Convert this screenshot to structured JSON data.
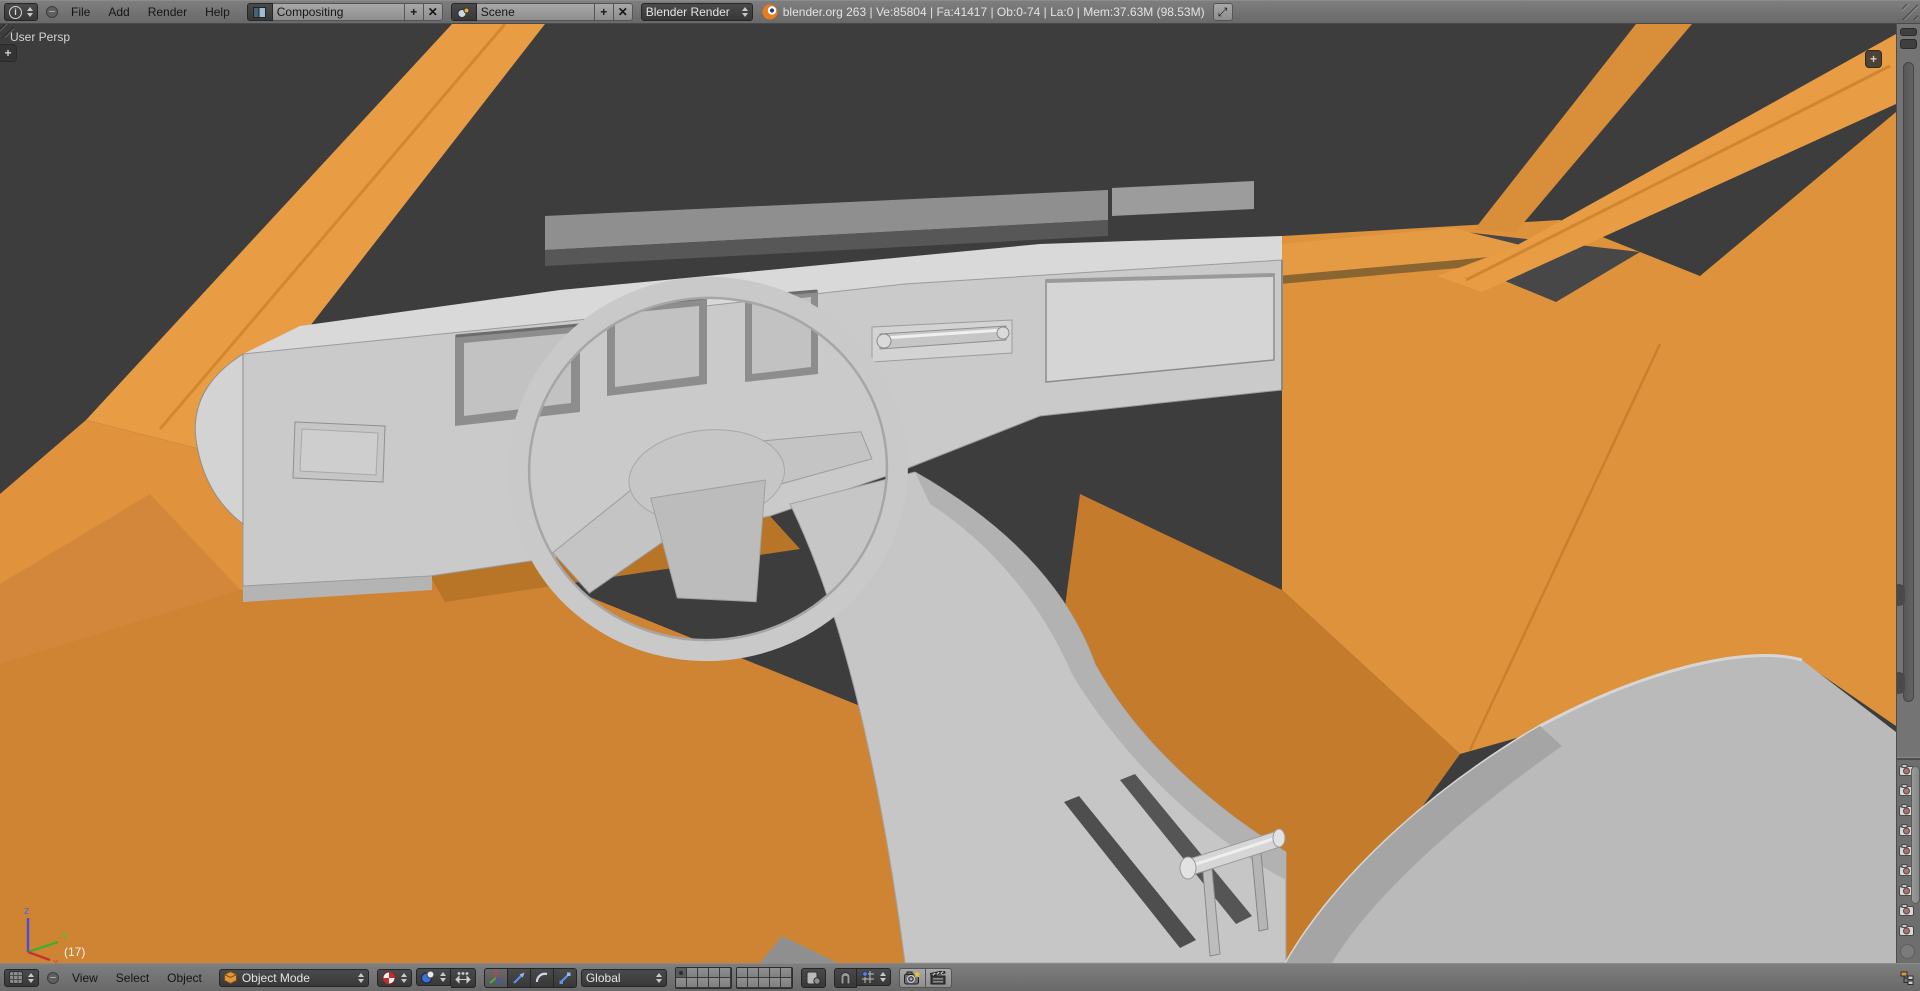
{
  "icons": {
    "plus": "+",
    "close": "✕",
    "collapse": "–",
    "maximize": "⤢",
    "info": "i"
  },
  "topbar": {
    "menus": [
      "File",
      "Add",
      "Render",
      "Help"
    ],
    "layout_value": "Compositing",
    "scene_value": "Scene",
    "engine_value": "Blender Render",
    "stats": "blender.org 263 | Ve:85804 | Fa:41417 | Ob:0-74 | La:0 | Mem:37.63M (98.53M)"
  },
  "viewport": {
    "view_label": "User Persp",
    "counter": "(17)",
    "axis": {
      "x": "x",
      "y": "Y",
      "z": "z"
    }
  },
  "view3d": {
    "menus": [
      "View",
      "Select",
      "Object"
    ],
    "mode_value": "Object Mode",
    "orientation_value": "Global"
  },
  "colors": {
    "object_orange": "#e2973e",
    "viewport_bg": "#3d3d3d",
    "header_gray": "#717171",
    "widget_dark": "#3a3a3a"
  }
}
